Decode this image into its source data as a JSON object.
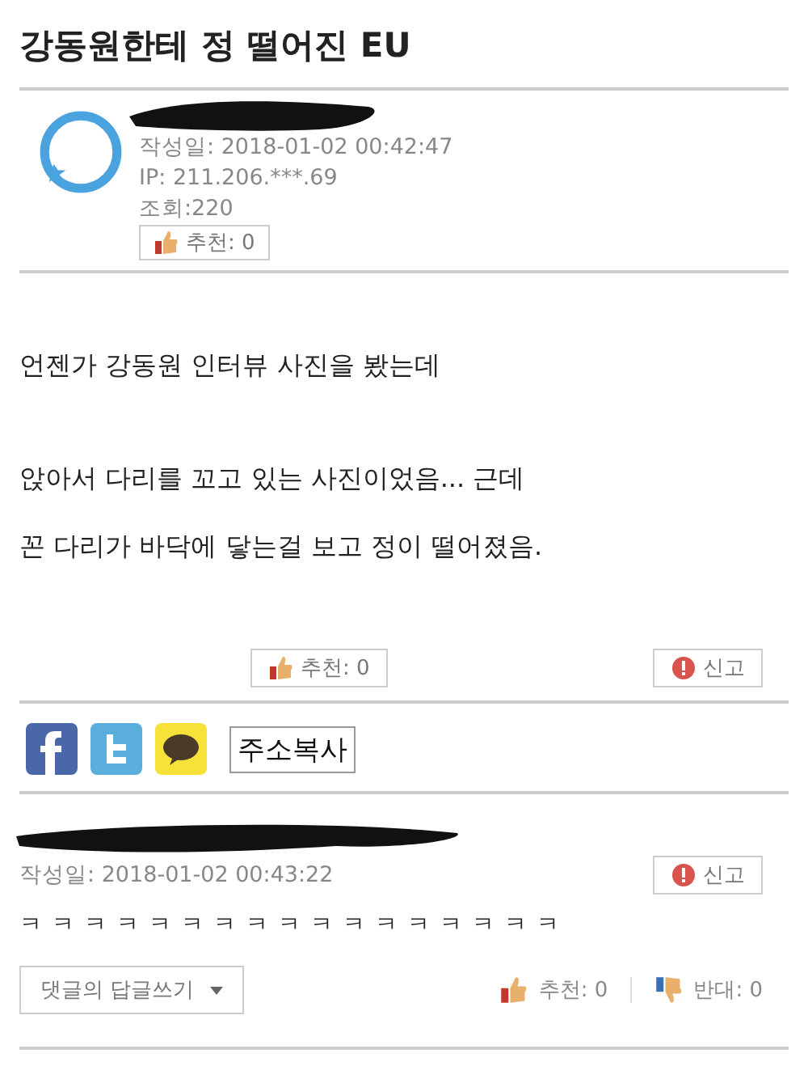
{
  "title": "강동원한테 정 떨어진 EU",
  "post": {
    "date": "작성일: 2018-01-02 00:42:47",
    "ip": "IP: 211.206.***.69",
    "views": "조회:220",
    "recommend": "추천: 0",
    "body": [
      [
        "언젠가 강동원 인터뷰 사진을 봤는데"
      ],
      [
        "앉아서 다리를 꼬고 있는 사진이었음... 근데",
        "꼰 다리가 바닥에 닿는걸 보고 정이 떨어졌음."
      ]
    ],
    "recommend_bottom": "추천: 0",
    "report": "신고"
  },
  "share": {
    "copy_address": "주소복사"
  },
  "comment": {
    "date": "작성일: 2018-01-02 00:43:22",
    "report": "신고",
    "text": "ㅋㅋㅋㅋㅋㅋㅋㅋㅋㅋㅋㅋㅋㅋㅋㅋㅋ",
    "reply": "댓글의 답글쓰기",
    "recommend": "추천: 0",
    "oppose": "반대: 0"
  }
}
